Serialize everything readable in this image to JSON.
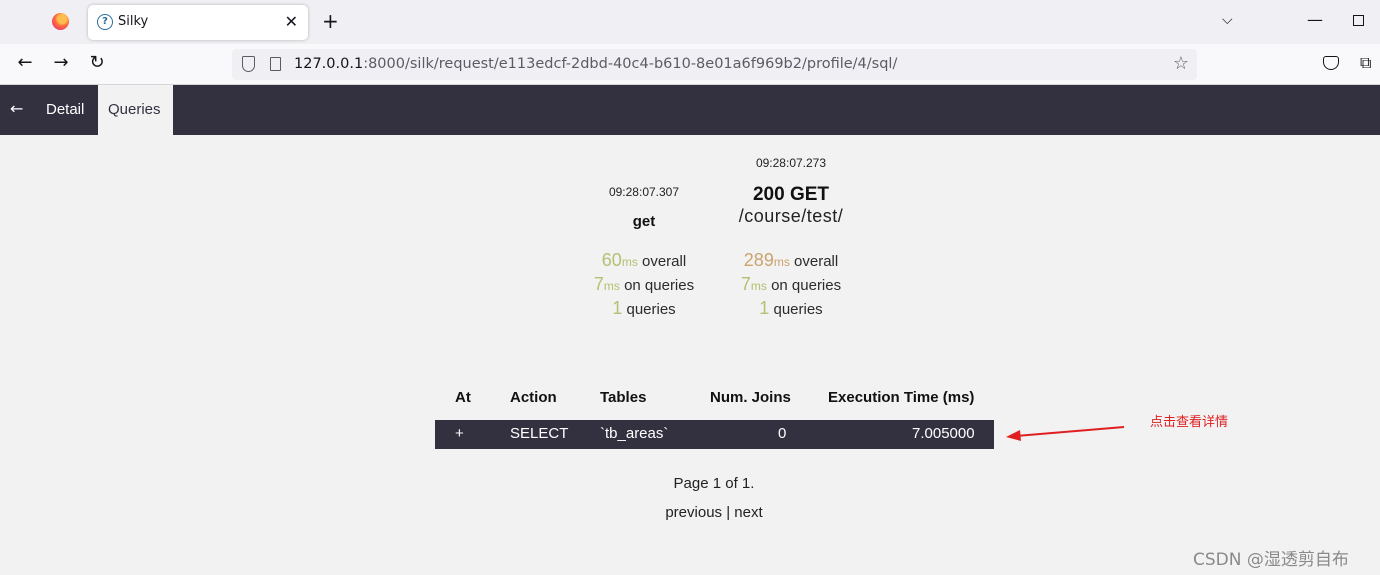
{
  "browser": {
    "tab_title": "Silky",
    "tab_close": "✕",
    "new_tab": "+",
    "tab_list": "⌵",
    "win_min": "—",
    "url_host": "127.0.0.1",
    "url_rest": ":8000/silk/request/e113edcf-2dbd-40c4-b610-8e01a6f969b2/profile/4/sql/",
    "back": "←",
    "forward": "→",
    "reload": "↻",
    "star": "☆",
    "extensions": "⧉"
  },
  "header": {
    "back_arrow": "←",
    "tabs": [
      {
        "label": "Detail"
      },
      {
        "label": "Queries"
      }
    ]
  },
  "profile": {
    "time": "09:28:07.307",
    "name": "get",
    "overall_ms": "60",
    "overall_label": "overall",
    "queries_ms": "7",
    "queries_label": "on queries",
    "num_queries": "1",
    "num_queries_label": "queries",
    "ms_unit": "ms"
  },
  "request": {
    "time": "09:28:07.273",
    "status_method": "200 GET",
    "path": "/course/test/",
    "overall_ms": "289",
    "overall_label": "overall",
    "queries_ms": "7",
    "queries_label": "on queries",
    "num_queries": "1",
    "num_queries_label": "queries",
    "ms_unit": "ms"
  },
  "table": {
    "headers": [
      "At",
      "Action",
      "Tables",
      "Num. Joins",
      "Execution Time (ms)"
    ],
    "rows": [
      {
        "at": "+",
        "action": "SELECT",
        "tables": "`tb_areas`",
        "joins": "0",
        "time": "7.005000"
      }
    ]
  },
  "pager": {
    "page_text": "Page 1 of 1.",
    "previous": "previous",
    "separator": "|",
    "next": "next"
  },
  "annotation": {
    "text": "点击查看详情",
    "color": "#e02020"
  },
  "watermark": "CSDN @湿透剪自布",
  "colors": {
    "header_bg": "#333140",
    "green_value": "#b5c071",
    "orange_value": "#cba36e"
  }
}
